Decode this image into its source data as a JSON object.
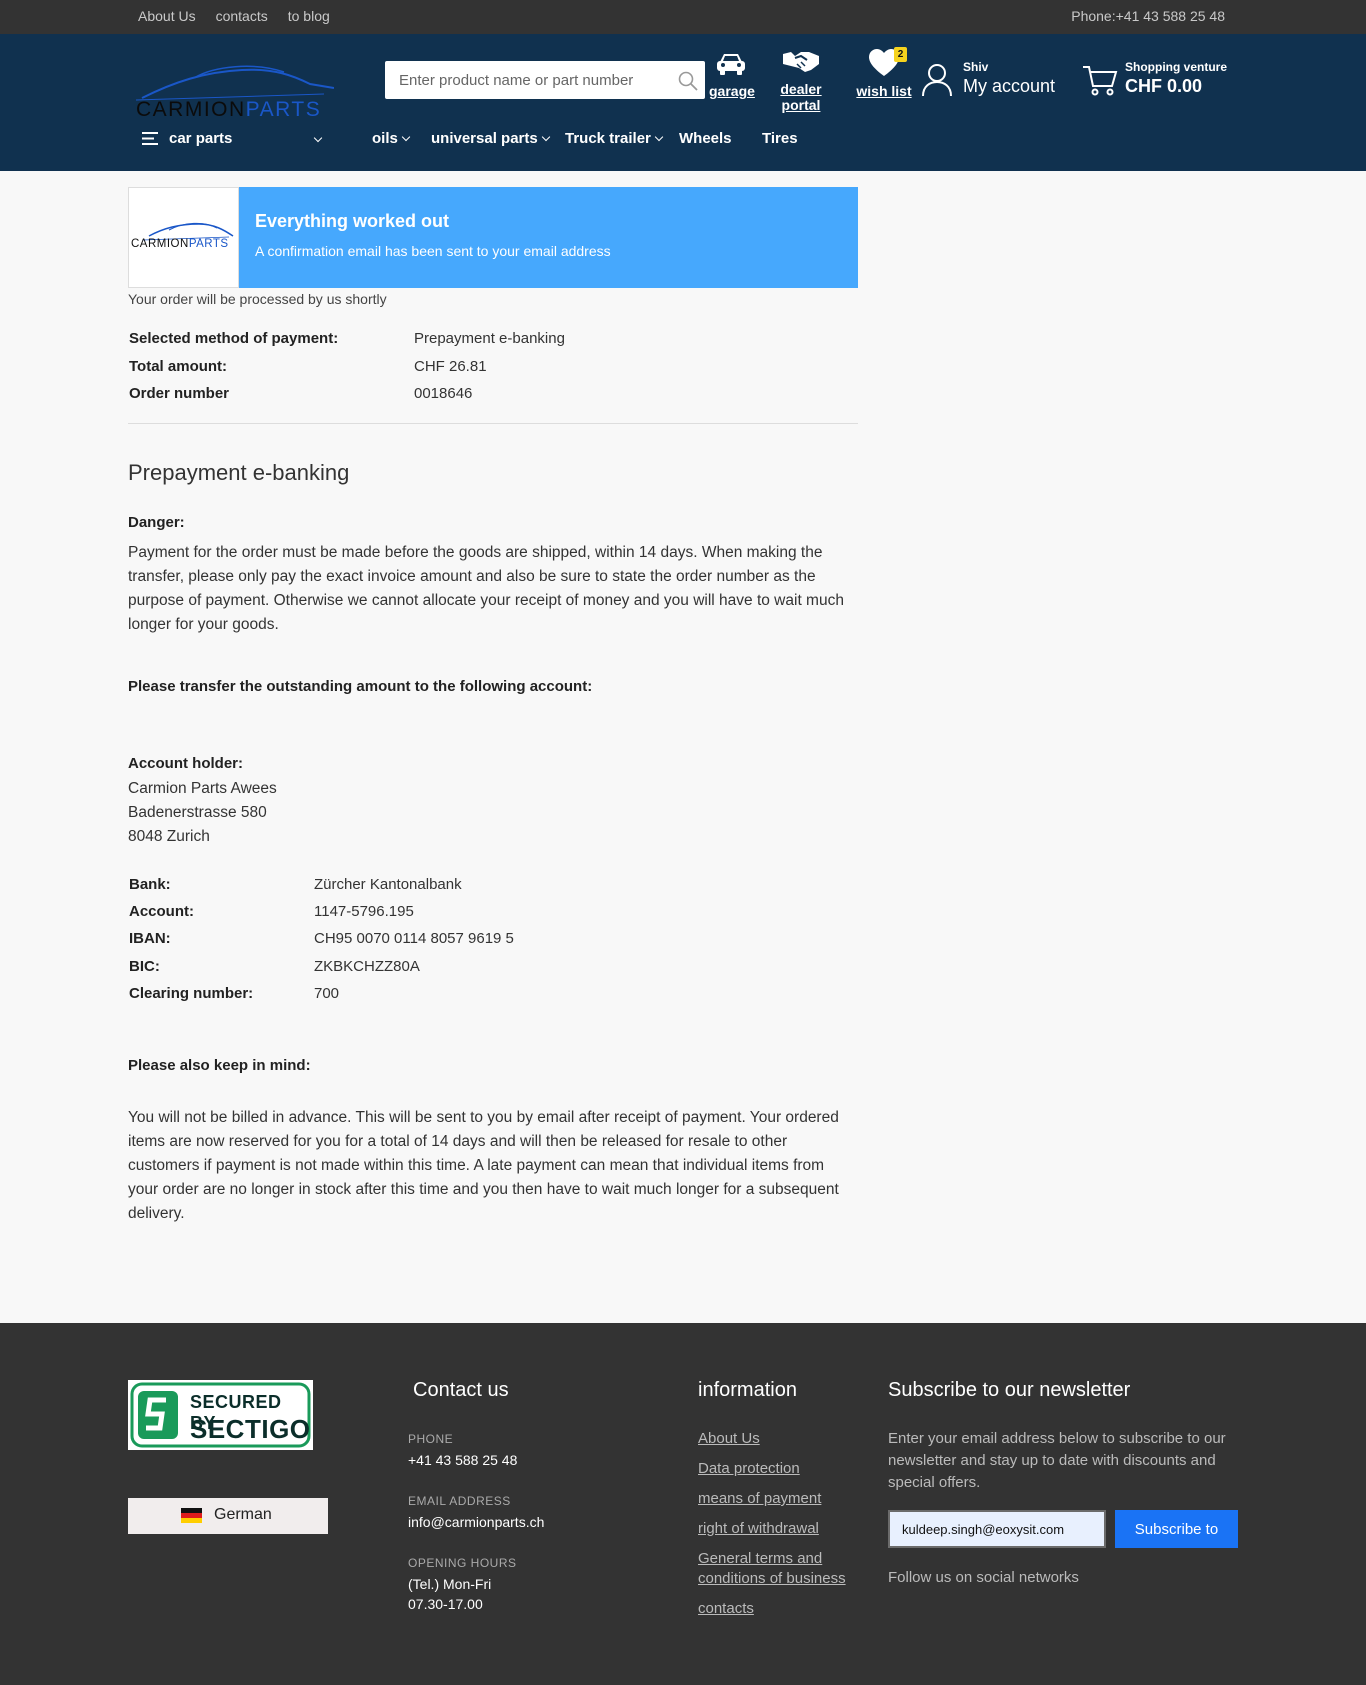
{
  "topbar": {
    "links": [
      "About Us",
      "contacts",
      "to blog"
    ],
    "phone": "Phone:+41 43 588 25 48"
  },
  "header": {
    "logo": {
      "word1": "CARMION",
      "word2": "PARTS"
    },
    "search": {
      "placeholder": "Enter product name or part number"
    },
    "garage_label": "garage",
    "dealer_label": "dealer portal",
    "wishlist_label": "wish list",
    "wishlist_count": "2",
    "account_name": "Shiv",
    "account_label": "My account",
    "cart_label": "Shopping venture",
    "cart_total": "CHF 0.00"
  },
  "nav": {
    "car_parts": "car parts",
    "oils": "oils",
    "universal_parts": "universal parts",
    "truck_trailer": "Truck trailer",
    "wheels": "Wheels",
    "tires": "Tires"
  },
  "notice": {
    "title": "Everything worked out",
    "subtitle": "A confirmation email has been sent to your email address",
    "processed": "Your order will be processed by us shortly"
  },
  "order": [
    {
      "label": "Selected method of payment:",
      "value": "Prepayment e-banking"
    },
    {
      "label": "Total amount:",
      "value": "CHF 26.81"
    },
    {
      "label": "Order number",
      "value": "0018646"
    }
  ],
  "payment": {
    "heading": "Prepayment e-banking",
    "danger_label": "Danger:",
    "danger_text": "Payment for the order must be made before the goods are shipped, within 14 days. When making the transfer, please only pay the exact invoice amount and also be sure to state the order number as the purpose of payment. Otherwise we cannot allocate your receipt of money and you will have to wait much longer for your goods.",
    "transfer_text": "Please transfer the outstanding amount to the following account:",
    "holder_label": "Account holder:",
    "holder_lines": [
      "Carmion Parts Awees",
      "Badenerstrasse 580",
      "8048 Zurich"
    ],
    "bank_rows": [
      {
        "label": "Bank:",
        "value": "Zürcher Kantonalbank"
      },
      {
        "label": "Account:",
        "value": "1147-5796.195"
      },
      {
        "label": "IBAN:",
        "value": "CH95 0070 0114 8057 9619 5"
      },
      {
        "label": "BIC:",
        "value": "ZKBKCHZZ80A"
      },
      {
        "label": "Clearing number:",
        "value": "700"
      }
    ],
    "keep_label": "Please also keep in mind:",
    "keep_text": "You will not be billed in advance. This will be sent to you by email after receipt of payment. Your ordered items are now reserved for you for a total of 14 days and will then be released for resale to other customers if payment is not made within this time. A late payment can mean that individual items from your order are no longer in stock after this time and you then have to wait much longer for a subsequent delivery."
  },
  "footer": {
    "badge": {
      "line1": "SECURED BY",
      "line2": "SECTIGO"
    },
    "language": "German",
    "contact": {
      "heading": "Contact us",
      "phone_label": "PHONE",
      "phone": "+41 43 588 25 48",
      "email_label": "EMAIL ADDRESS",
      "email": "info@carmionparts.ch",
      "hours_label": "OPENING HOURS",
      "hours_line1": "(Tel.) Mon-Fri",
      "hours_line2": "07.30-17.00"
    },
    "information": {
      "heading": "information",
      "links": [
        "About Us",
        "Data protection",
        "means of payment",
        "right of withdrawal",
        "General terms and conditions of business",
        "contacts"
      ]
    },
    "newsletter": {
      "heading": "Subscribe to our newsletter",
      "text": "Enter your email address below to subscribe to our newsletter and stay up to date with discounts and special offers.",
      "email_value": "kuldeep.singh@eoxysit.com",
      "button": "Subscribe to",
      "social": "Follow us on social networks"
    }
  },
  "colors": {
    "header": "#10314f",
    "topbar": "#333333",
    "notice": "#46a8fd",
    "accent": "#1a73f5"
  }
}
